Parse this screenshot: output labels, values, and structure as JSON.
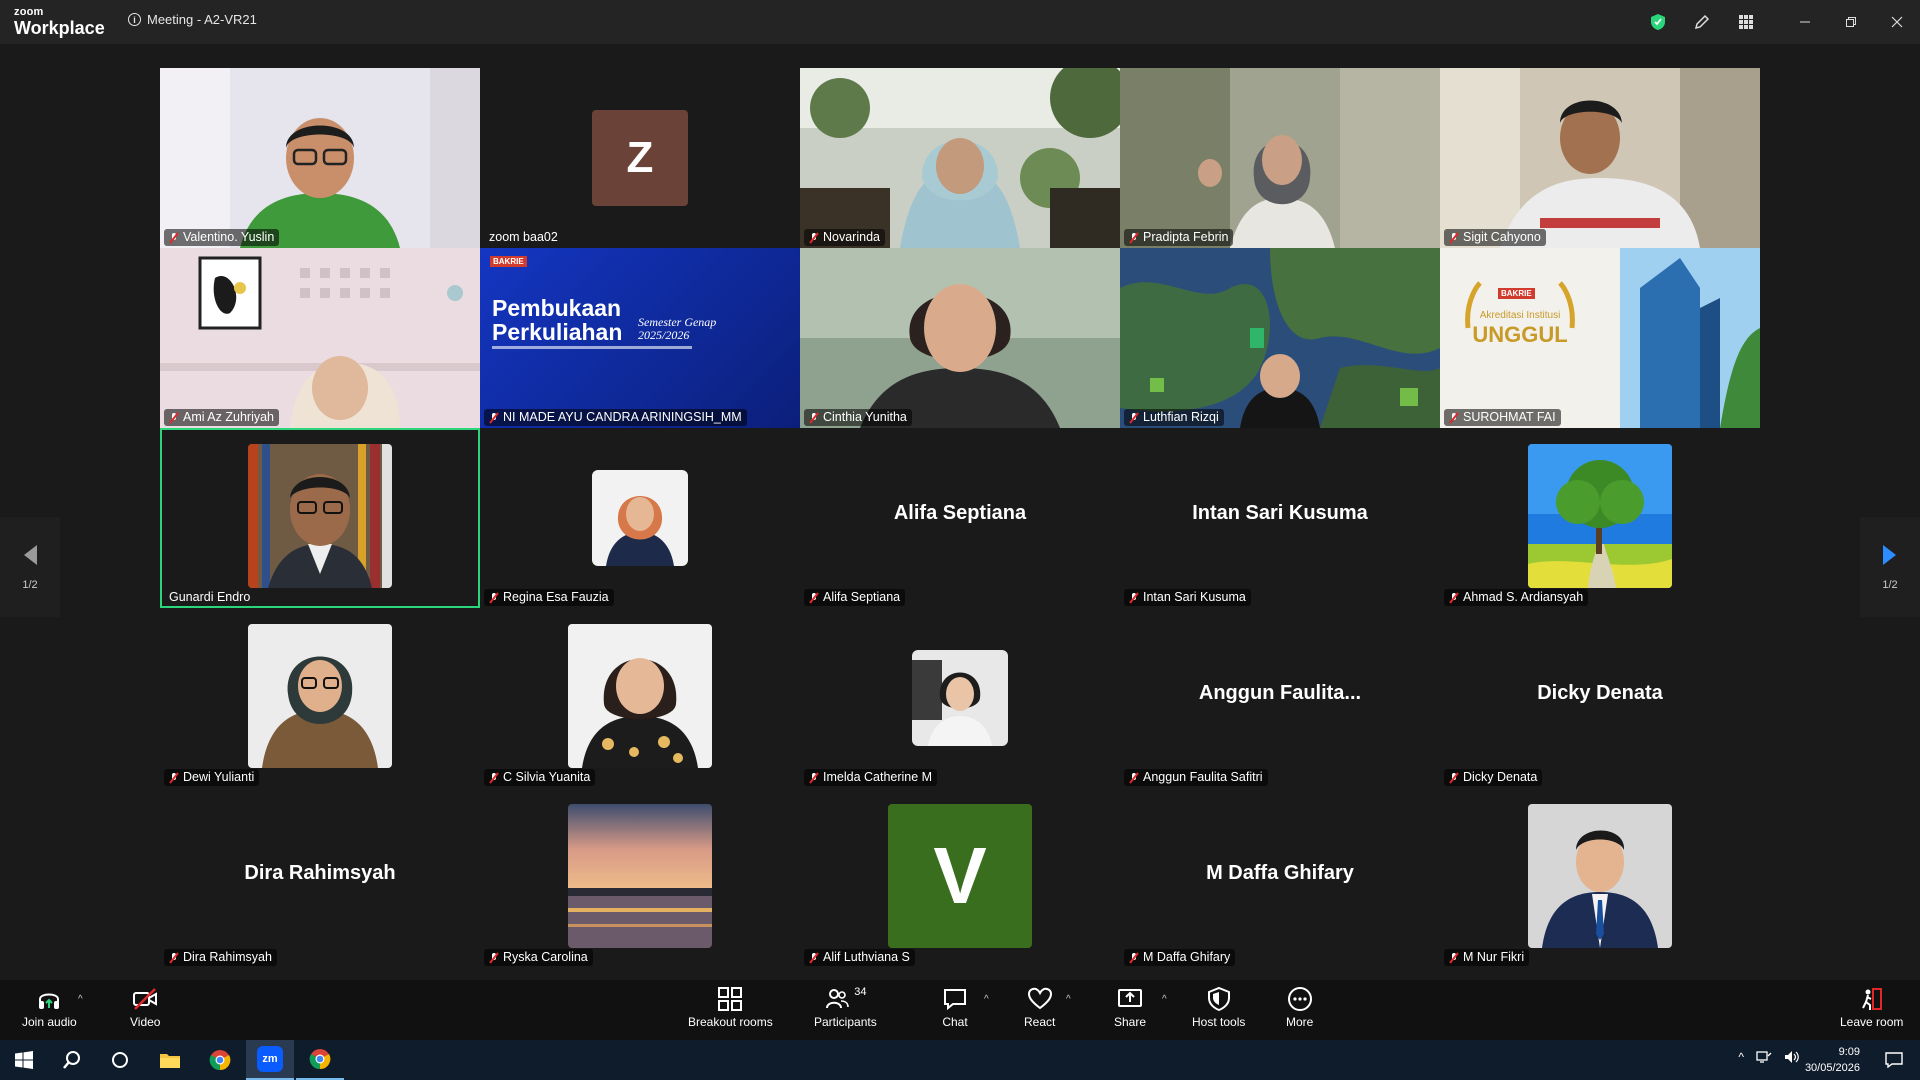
{
  "app": {
    "brand_small": "zoom",
    "brand_large": "Workplace",
    "meeting_title": "Meeting - A2-VR21"
  },
  "tiles": [
    {
      "name": "Valentino. Yuslin",
      "muted": true
    },
    {
      "name": "zoom baa02",
      "muted": false,
      "letter": "Z"
    },
    {
      "name": "Novarinda",
      "muted": true
    },
    {
      "name": "Pradipta Febrin",
      "muted": true
    },
    {
      "name": "Sigit Cahyono",
      "muted": true
    },
    {
      "name": "Ami Az Zuhriyah",
      "muted": true
    },
    {
      "name": "NI MADE AYU CANDRA ARININGSIH_MM",
      "muted": true
    },
    {
      "name": "Cinthia Yunitha",
      "muted": true
    },
    {
      "name": "Luthfian Rizqi",
      "muted": true
    },
    {
      "name": "SUROHMAT FAI",
      "muted": true
    },
    {
      "name": "Gunardi Endro",
      "muted": false
    },
    {
      "name": "Regina Esa Fauzia",
      "muted": true
    },
    {
      "name": "Alifa Septiana",
      "muted": true,
      "display": "Alifa Septiana"
    },
    {
      "name": "Intan Sari Kusuma",
      "muted": true,
      "display": "Intan Sari Kusuma"
    },
    {
      "name": "Ahmad S. Ardiansyah",
      "muted": true
    },
    {
      "name": "Dewi Yulianti",
      "muted": true
    },
    {
      "name": "C Silvia Yuanita",
      "muted": true
    },
    {
      "name": "Imelda Catherine M",
      "muted": true
    },
    {
      "name": "Anggun Faulita Safitri",
      "muted": true,
      "display": "Anggun  Faulita..."
    },
    {
      "name": "Dicky Denata",
      "muted": true,
      "display": "Dicky Denata"
    },
    {
      "name": "Dira Rahimsyah",
      "muted": true,
      "display": "Dira Rahimsyah"
    },
    {
      "name": "Ryska Carolina",
      "muted": true
    },
    {
      "name": "Alif Luthviana S",
      "muted": true,
      "letter": "V"
    },
    {
      "name": "M Daffa Ghifary",
      "muted": true,
      "display": "M Daffa Ghifary"
    },
    {
      "name": "M Nur Fikri",
      "muted": true
    }
  ],
  "slide": {
    "title1": "Pembukaan",
    "title2": "Perkuliahan",
    "subtitle1": "Semester Genap",
    "subtitle2": "2025/2026",
    "logo": "BAKRIE"
  },
  "accred": {
    "line1": "Akreditasi Institusi",
    "line2": "UNGGUL",
    "logo": "BAKRIE"
  },
  "nav": {
    "page_left": "1/2",
    "page_right": "1/2"
  },
  "toolbar": {
    "join_audio": "Join audio",
    "video": "Video",
    "breakout": "Breakout rooms",
    "participants": "Participants",
    "participants_count": "34",
    "chat": "Chat",
    "react": "React",
    "share": "Share",
    "host_tools": "Host tools",
    "more": "More",
    "leave": "Leave room"
  },
  "taskbar": {
    "time": "9:09",
    "date": "30/05/2026",
    "zoom_label": "zm"
  },
  "colors": {
    "active_border": "#2bd67b",
    "mute_red": "#e02828",
    "accent_blue": "#0b5cff"
  }
}
